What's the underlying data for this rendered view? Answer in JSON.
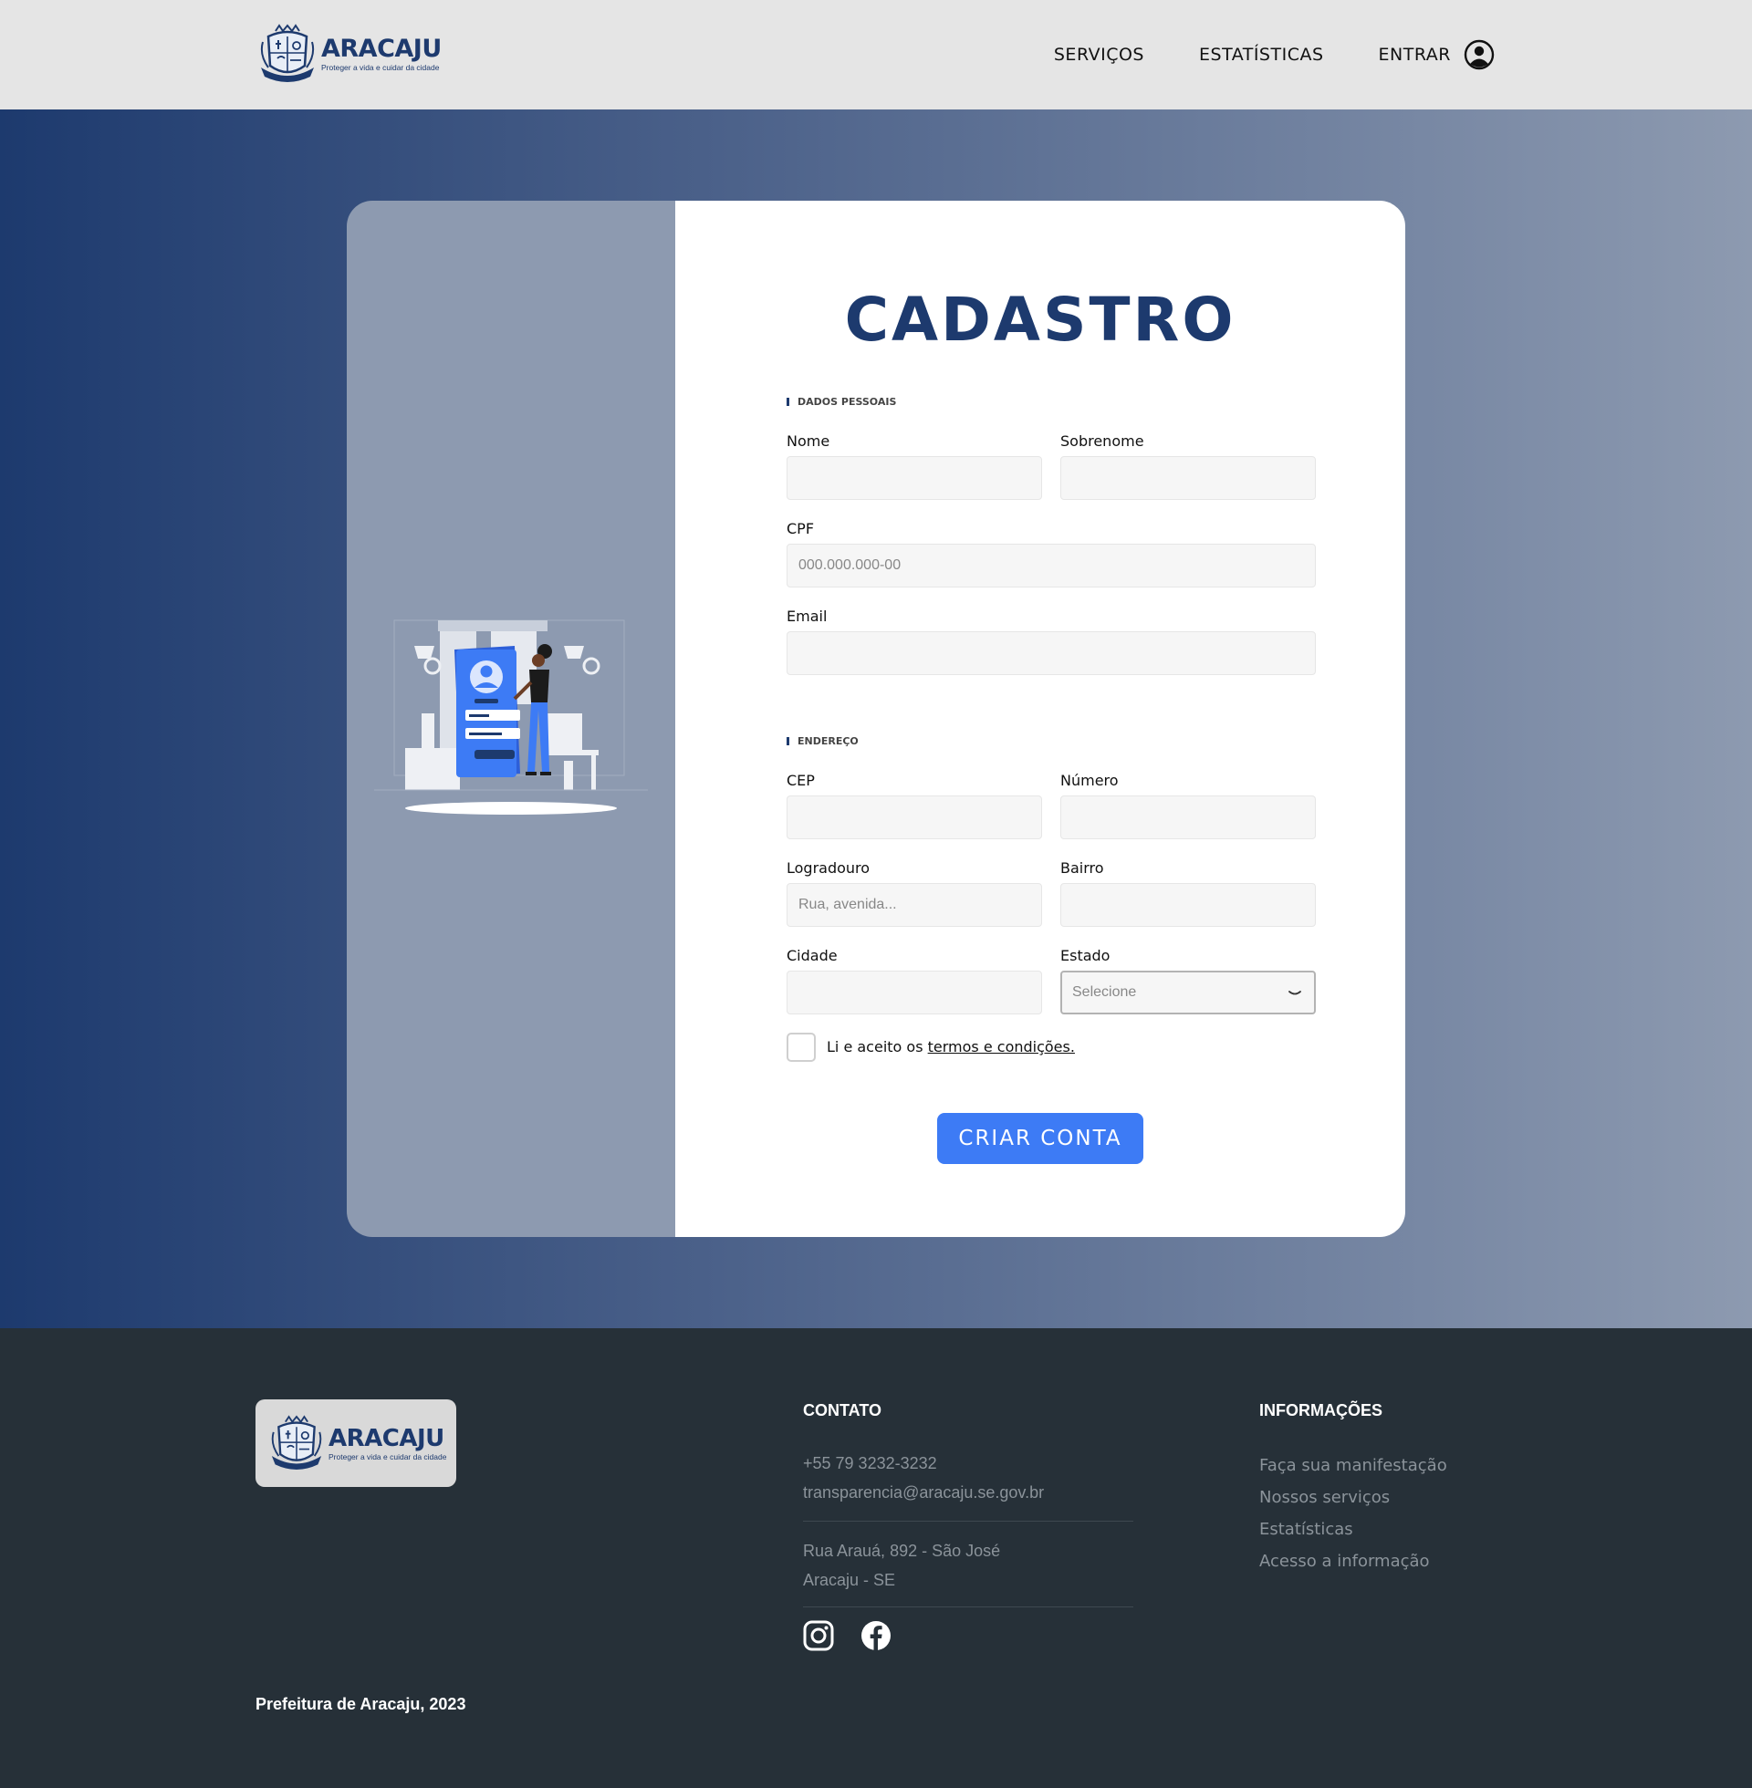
{
  "header": {
    "logo_name": "ARACAJU",
    "logo_tagline": "Proteger a vida e cuidar da cidade",
    "nav": {
      "services": "SERVIÇOS",
      "statistics": "ESTATÍSTICAS",
      "login": "ENTRAR"
    },
    "icons": {
      "user": "user-circle-icon",
      "crest": "city-crest-icon"
    }
  },
  "form": {
    "title": "CADASTRO",
    "sections": {
      "personal": "DADOS PESSOAIS",
      "address": "ENDEREÇO"
    },
    "fields": {
      "nome": {
        "label": "Nome",
        "value": "",
        "placeholder": ""
      },
      "sobrenome": {
        "label": "Sobrenome",
        "value": "",
        "placeholder": ""
      },
      "cpf": {
        "label": "CPF",
        "value": "",
        "placeholder": "000.000.000-00"
      },
      "email": {
        "label": "Email",
        "value": "",
        "placeholder": ""
      },
      "cep": {
        "label": "CEP",
        "value": "",
        "placeholder": ""
      },
      "numero": {
        "label": "Número",
        "value": "",
        "placeholder": ""
      },
      "logradouro": {
        "label": "Logradouro",
        "value": "",
        "placeholder": "Rua, avenida..."
      },
      "bairro": {
        "label": "Bairro",
        "value": "",
        "placeholder": ""
      },
      "cidade": {
        "label": "Cidade",
        "value": "",
        "placeholder": ""
      },
      "estado": {
        "label": "Estado",
        "selected": "Selecione"
      }
    },
    "terms": {
      "prefix": "Li e aceito os ",
      "link": "termos e condições."
    },
    "submit_label": "CRIAR CONTA"
  },
  "footer": {
    "logo_name": "ARACAJU",
    "logo_tagline": "Proteger a vida e cuidar da cidade",
    "contact": {
      "heading": "CONTATO",
      "phone": "+55 79 3232-3232",
      "email": "transparencia@aracaju.se.gov.br",
      "address_line1": "Rua Arauá, 892 - São José",
      "address_line2": "Aracaju - SE"
    },
    "info": {
      "heading": "INFORMAÇÕES",
      "links": [
        "Faça sua manifestação",
        "Nossos serviços",
        "Estatísticas",
        "Acesso a informação"
      ]
    },
    "social_icons": [
      "instagram-icon",
      "facebook-icon"
    ],
    "copyright": "Prefeitura de Aracaju, 2023"
  },
  "colors": {
    "brand_navy": "#1d3a6e",
    "button_blue": "#3d7bf5",
    "footer_bg": "#263038",
    "header_bg": "#e5e5e5"
  }
}
